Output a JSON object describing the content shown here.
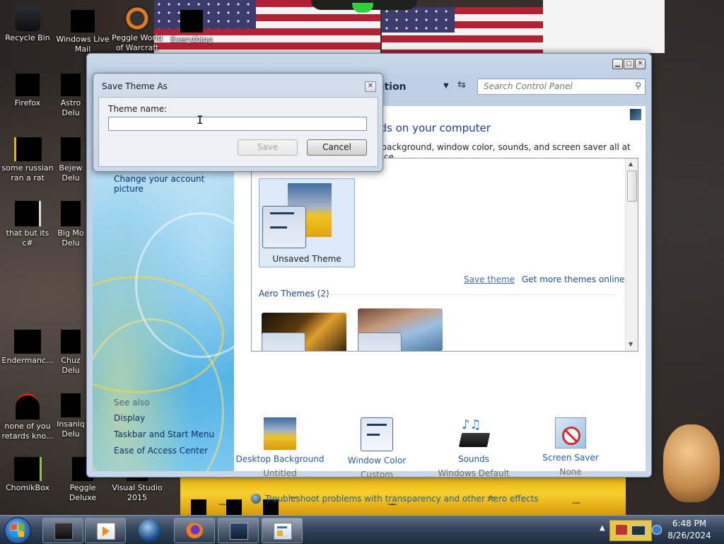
{
  "desktop": {
    "icons": [
      {
        "label": "Recycle Bin",
        "icon": "recycle-bin-icon"
      },
      {
        "label": "Windows Live Mail",
        "icon": "windows-live-mail-icon"
      },
      {
        "label": "Peggle World of Warcraft",
        "icon": "peggle-icon"
      },
      {
        "label": "Everything",
        "icon": "everything-icon"
      },
      {
        "label": "Firefox",
        "icon": "firefox-icon"
      },
      {
        "label": "Astro Delu",
        "icon": "game-icon"
      },
      {
        "label": "some russian ran a rat",
        "icon": "file-icon"
      },
      {
        "label": "Bejew Delu",
        "icon": "game-icon"
      },
      {
        "label": "that but its c#",
        "icon": "file-icon"
      },
      {
        "label": "Big Mo Delu",
        "icon": "game-icon"
      },
      {
        "label": "Endermanc...",
        "icon": "file-icon"
      },
      {
        "label": "Chuz Delu",
        "icon": "game-icon"
      },
      {
        "label": "none of you retards kno...",
        "icon": "file-icon"
      },
      {
        "label": "Insaniq Delu",
        "icon": "game-icon"
      },
      {
        "label": "ChomikBox",
        "icon": "chomikbox-icon"
      },
      {
        "label": "Peggle Deluxe",
        "icon": "peggle-deluxe-icon"
      },
      {
        "label": "Visual Studio 2015",
        "icon": "visual-studio-icon"
      }
    ]
  },
  "control_panel": {
    "breadcrumb_tail": "ation",
    "search_placeholder": "Search Control Panel",
    "heading_tail": "nds on your computer",
    "subheading_tail": "p background, window color, sounds, and screen saver all at once.",
    "left_links": {
      "account_picture": "Change your account picture",
      "see_also": "See also",
      "display": "Display",
      "taskbar": "Taskbar and Start Menu",
      "ease": "Ease of Access Center"
    },
    "unsaved_theme_label": "Unsaved Theme",
    "save_theme_link": "Save theme",
    "more_themes_link": "Get more themes online",
    "aero_header": "Aero Themes (2)",
    "bottom_items": [
      {
        "title": "Desktop Background",
        "value": "Untitled",
        "icon": "desktop-background-icon"
      },
      {
        "title": "Window Color",
        "value": "Custom",
        "icon": "window-color-icon"
      },
      {
        "title": "Sounds",
        "value": "Windows Default",
        "icon": "sounds-icon"
      },
      {
        "title": "Screen Saver",
        "value": "None",
        "icon": "screen-saver-icon"
      }
    ],
    "troubleshoot_link": "Troubleshoot problems with transparency and other Aero effects"
  },
  "dialog": {
    "title": "Save Theme As",
    "label": "Theme name:",
    "input_value": "",
    "save_label": "Save",
    "cancel_label": "Cancel",
    "close_glyph": "✕"
  },
  "taskbar": {
    "items": [
      "app-icon",
      "media-player-icon",
      "globe-icon",
      "firefox-icon",
      "monitor-icon",
      "control-panel-icon"
    ],
    "time": "6:48 PM",
    "date": "8/26/2024"
  },
  "colors": {
    "link_blue": "#1e5ea8",
    "heading_blue": "#1a3f96",
    "window_frame": "#c9d8ea"
  }
}
